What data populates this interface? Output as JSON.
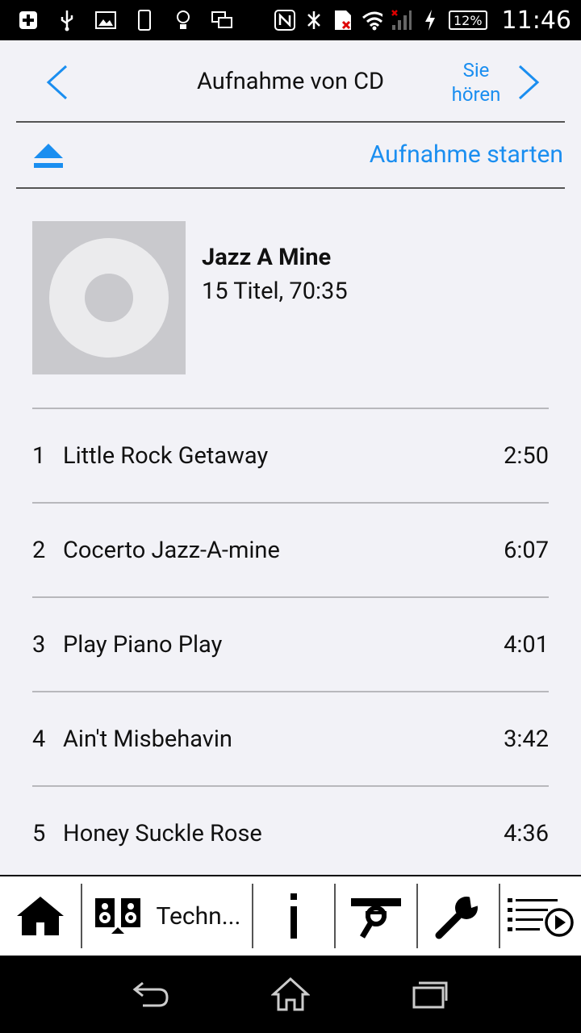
{
  "status_bar": {
    "battery": "12%",
    "time": "11:46"
  },
  "header": {
    "title": "Aufnahme von CD",
    "next_label": "Sie hören"
  },
  "actions": {
    "start_label": "Aufnahme starten"
  },
  "album": {
    "title": "Jazz A Mine",
    "subtitle": "15 Titel, 70:35"
  },
  "tracks": [
    {
      "num": "1",
      "title": "Little Rock Getaway",
      "duration": "2:50"
    },
    {
      "num": "2",
      "title": "Cocerto Jazz-A-mine",
      "duration": "6:07"
    },
    {
      "num": "3",
      "title": "Play Piano Play",
      "duration": "4:01"
    },
    {
      "num": "4",
      "title": "Ain't Misbehavin",
      "duration": "3:42"
    },
    {
      "num": "5",
      "title": "Honey Suckle Rose",
      "duration": "4:36"
    }
  ],
  "toolbar": {
    "source_label": "Techn..."
  },
  "colors": {
    "accent": "#1a8ef0",
    "background": "#f2f2f7"
  }
}
